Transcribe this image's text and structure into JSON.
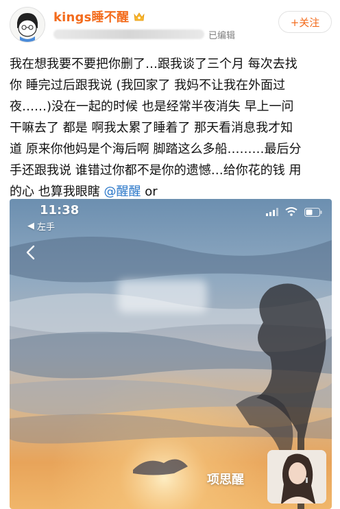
{
  "user": {
    "name": "kings睡不醒",
    "edited_label": "已编辑",
    "follow_label": "+关注"
  },
  "post": {
    "lines": [
      "我在想我要不要把你删了…跟我谈了三个月 每次去找",
      "你 睡完过后跟我说 (我回家了 我妈不让我在外面过",
      "夜……)没在一起的时候 也是经常半夜消失 早上一问",
      "干嘛去了 都是 啊我太累了睡着了 那天看消息我才知",
      "道 原来你他妈是个海后啊 脚踏这么多船………最后分",
      "手还跟我说 谁错过你都不是你的遗憾…给你花的钱 用"
    ],
    "last_line": "的心 也算我眼瞎",
    "mention": "@醒醒",
    "trailing": " or"
  },
  "screenshot": {
    "time": "11:38",
    "back_app_label": "左手",
    "watermark": "项思醒"
  },
  "icons": {
    "vip": "vip-crown-icon",
    "follow": "plus-icon",
    "back": "chevron-left-icon",
    "signal": "signal-icon",
    "wifi": "wifi-icon",
    "battery": "battery-icon"
  },
  "colors": {
    "username": "#f36b1c",
    "mention": "#2a77c9",
    "follow": "#f36b1c"
  }
}
